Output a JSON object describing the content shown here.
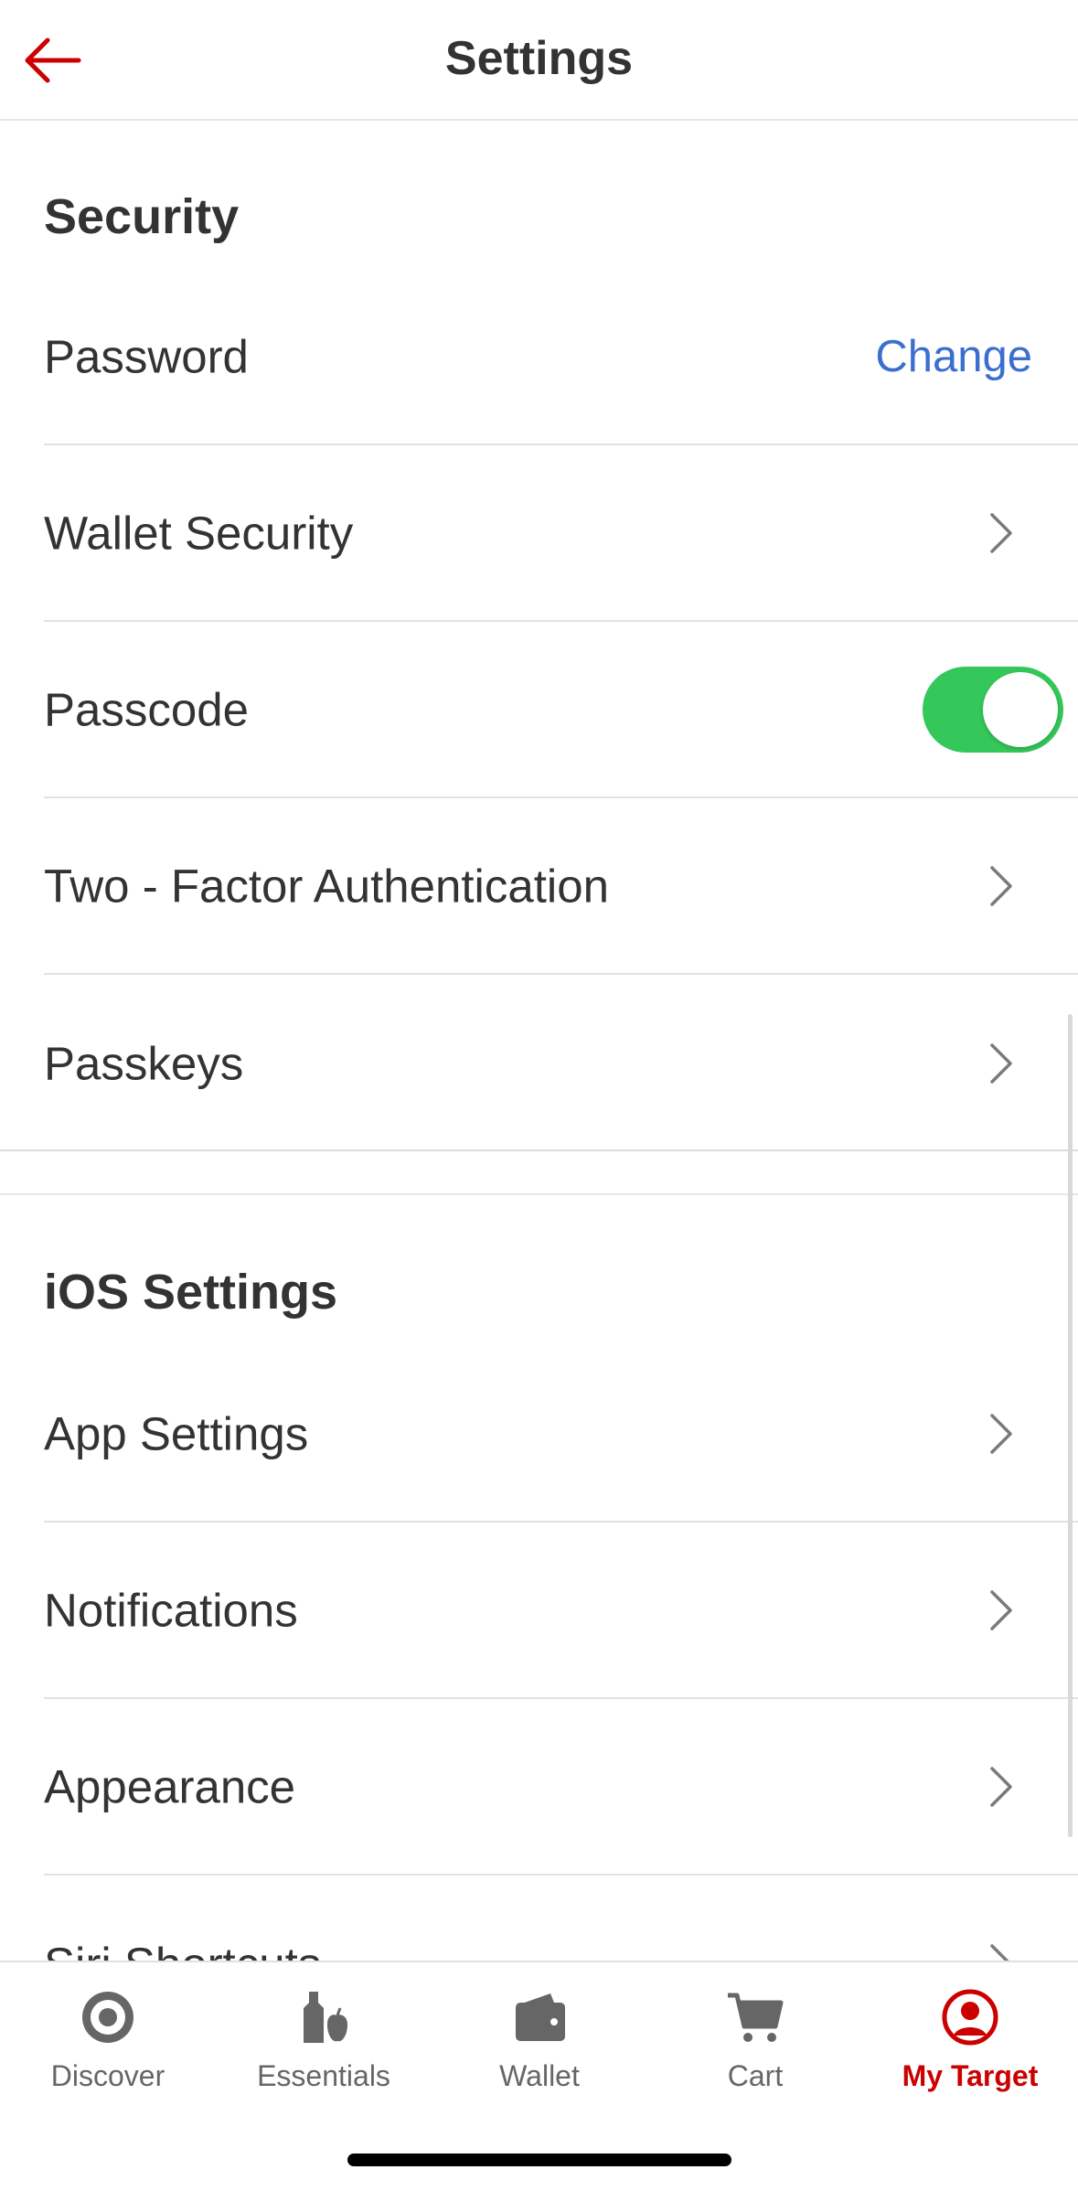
{
  "header": {
    "title": "Settings",
    "back_icon": "arrow-left-icon"
  },
  "security": {
    "title": "Security",
    "password_label": "Password",
    "password_action": "Change",
    "wallet_security_label": "Wallet Security",
    "passcode_label": "Passcode",
    "passcode_enabled": true,
    "two_factor_label": "Two - Factor Authentication",
    "passkeys_label": "Passkeys"
  },
  "ios_settings": {
    "title": "iOS Settings",
    "app_settings_label": "App Settings",
    "notifications_label": "Notifications",
    "appearance_label": "Appearance",
    "siri_shortcuts_label": "Siri Shortcuts"
  },
  "tabbar": {
    "tabs": [
      {
        "label": "Discover",
        "icon": "target-icon"
      },
      {
        "label": "Essentials",
        "icon": "essentials-icon"
      },
      {
        "label": "Wallet",
        "icon": "wallet-icon"
      },
      {
        "label": "Cart",
        "icon": "cart-icon"
      },
      {
        "label": "My Target",
        "icon": "user-circle-icon"
      }
    ],
    "active": "My Target"
  },
  "colors": {
    "accent": "#cc0000",
    "link": "#3a6fd0",
    "toggle_on": "#34c759"
  }
}
